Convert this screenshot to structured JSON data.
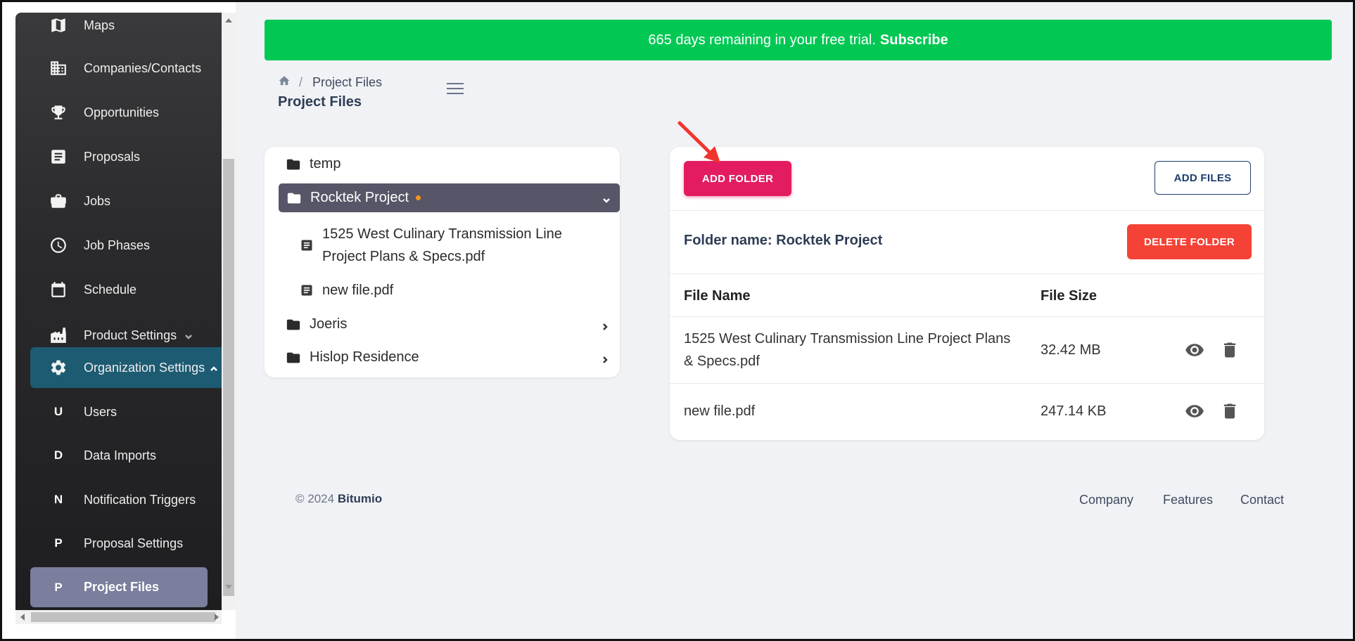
{
  "sidebar": {
    "items": [
      {
        "label": "Maps",
        "icon": "map-icon"
      },
      {
        "label": "Companies/Contacts",
        "icon": "building-icon"
      },
      {
        "label": "Opportunities",
        "icon": "trophy-icon"
      },
      {
        "label": "Proposals",
        "icon": "document-icon"
      },
      {
        "label": "Jobs",
        "icon": "briefcase-icon"
      },
      {
        "label": "Job Phases",
        "icon": "clock-icon"
      },
      {
        "label": "Schedule",
        "icon": "calendar-icon"
      },
      {
        "label": "Product Settings",
        "icon": "factory-icon"
      },
      {
        "label": "Organization Settings",
        "icon": "gear-icon"
      }
    ],
    "sub_items": [
      {
        "letter": "U",
        "label": "Users"
      },
      {
        "letter": "D",
        "label": "Data Imports"
      },
      {
        "letter": "N",
        "label": "Notification Triggers"
      },
      {
        "letter": "P",
        "label": "Proposal Settings"
      },
      {
        "letter": "P",
        "label": "Project Files"
      }
    ]
  },
  "banner": {
    "text": "665 days remaining in your free trial.",
    "link": "Subscribe"
  },
  "breadcrumb": {
    "current": "Project Files"
  },
  "page_title": "Project Files",
  "tree": {
    "folders": [
      {
        "name": "temp"
      },
      {
        "name": "Rocktek Project"
      },
      {
        "name": "Joeris"
      },
      {
        "name": "Hislop Residence"
      }
    ],
    "files": [
      {
        "name_line1": "1525 West Culinary Transmission Line",
        "name_line2": "Project Plans & Specs.pdf"
      },
      {
        "name_line1": "new file.pdf"
      }
    ]
  },
  "files_panel": {
    "add_folder": "ADD FOLDER",
    "add_files": "ADD FILES",
    "folder_name_label": "Folder name: Rocktek Project",
    "delete_folder": "DELETE FOLDER",
    "columns": [
      "File Name",
      "File Size"
    ],
    "rows": [
      {
        "name_line1": "1525 West Culinary Transmission Line Project Plans",
        "name_line2": "& Specs.pdf",
        "size": "32.42 MB"
      },
      {
        "name_line1": "new file.pdf",
        "size": "247.14 KB"
      }
    ]
  },
  "footer": {
    "copyright": "© 2024",
    "brand": "Bitumio",
    "links": [
      "Company",
      "Features",
      "Contact"
    ]
  },
  "colors": {
    "banner": "#00c853",
    "add_folder": "#e31c62",
    "delete_folder": "#f44336",
    "org_settings_bg": "#1d5b72",
    "active_item_bg": "#7b7e9c",
    "selected_folder_bg": "#565668",
    "dot": "#f7941d"
  }
}
